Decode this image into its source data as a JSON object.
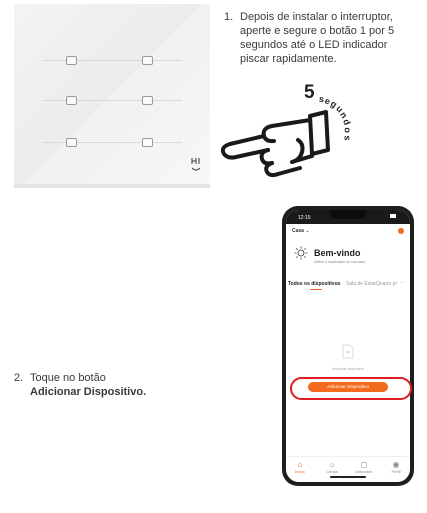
{
  "step1": {
    "number": "1.",
    "text_lines": [
      "Depois de instalar o interruptor,",
      "aperte e segure o botão 1 por 5",
      "segundos até o LED indicador",
      "piscar rapidamente."
    ],
    "timer_number": "5",
    "timer_letters": [
      "s",
      "e",
      "g",
      "u",
      "n",
      "d",
      "o",
      "s"
    ]
  },
  "step2": {
    "number": "2.",
    "text": "Toque no botão",
    "bold": "Adicionar Dispositivo."
  },
  "phone": {
    "time": "12:15",
    "home_selector": "Casa",
    "welcome_title": "Bem-vindo",
    "welcome_subtitle": "Defina a localização da sua casa",
    "tabs": [
      "Todos os dispositivos",
      "Sala de Estar",
      "Quarto pr"
    ],
    "tab_more": "···",
    "empty_text": "Adicionar dispositivo",
    "add_device_button": "Adicionar Dispositivo",
    "nav": [
      "Início",
      "Cenas",
      "Descobrir",
      "Perfil"
    ],
    "accent_color": "#f26b1d",
    "highlight_color": "#e01d22"
  }
}
